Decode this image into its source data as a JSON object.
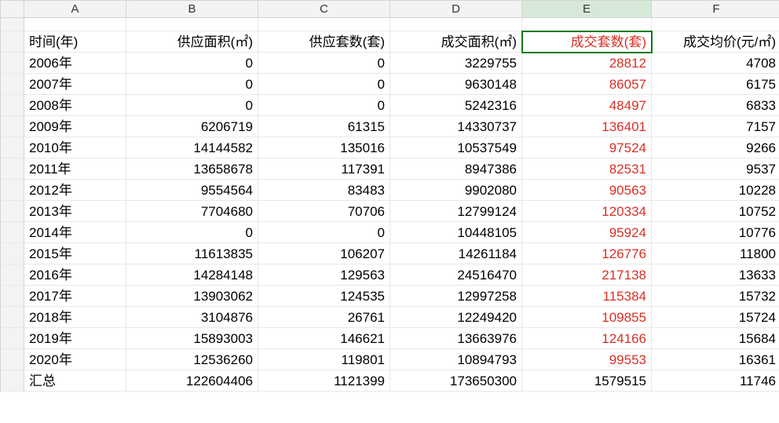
{
  "columns": [
    "",
    "A",
    "B",
    "C",
    "D",
    "E",
    "F"
  ],
  "selected": {
    "col": 5,
    "row": 2
  },
  "header": {
    "A": "时间(年)",
    "B": "供应面积(㎡)",
    "C": "供应套数(套)",
    "D": "成交面积(㎡)",
    "E": "成交套数(套)",
    "F": "成交均价(元/㎡)"
  },
  "rows": [
    {
      "A": "2006年",
      "B": 0,
      "C": 0,
      "D": 3229755,
      "E": 28812,
      "F": 4708
    },
    {
      "A": "2007年",
      "B": 0,
      "C": 0,
      "D": 9630148,
      "E": 86057,
      "F": 6175
    },
    {
      "A": "2008年",
      "B": 0,
      "C": 0,
      "D": 5242316,
      "E": 48497,
      "F": 6833
    },
    {
      "A": "2009年",
      "B": 6206719,
      "C": 61315,
      "D": 14330737,
      "E": 136401,
      "F": 7157
    },
    {
      "A": "2010年",
      "B": 14144582,
      "C": 135016,
      "D": 10537549,
      "E": 97524,
      "F": 9266
    },
    {
      "A": "2011年",
      "B": 13658678,
      "C": 117391,
      "D": 8947386,
      "E": 82531,
      "F": 9537
    },
    {
      "A": "2012年",
      "B": 9554564,
      "C": 83483,
      "D": 9902080,
      "E": 90563,
      "F": 10228
    },
    {
      "A": "2013年",
      "B": 7704680,
      "C": 70706,
      "D": 12799124,
      "E": 120334,
      "F": 10752
    },
    {
      "A": "2014年",
      "B": 0,
      "C": 0,
      "D": 10448105,
      "E": 95924,
      "F": 10776
    },
    {
      "A": "2015年",
      "B": 11613835,
      "C": 106207,
      "D": 14261184,
      "E": 126776,
      "F": 11800
    },
    {
      "A": "2016年",
      "B": 14284148,
      "C": 129563,
      "D": 24516470,
      "E": 217138,
      "F": 13633
    },
    {
      "A": "2017年",
      "B": 13903062,
      "C": 124535,
      "D": 12997258,
      "E": 115384,
      "F": 15732
    },
    {
      "A": "2018年",
      "B": 3104876,
      "C": 26761,
      "D": 12249420,
      "E": 109855,
      "F": 15724
    },
    {
      "A": "2019年",
      "B": 15893003,
      "C": 146621,
      "D": 13663976,
      "E": 124166,
      "F": 15684
    },
    {
      "A": "2020年",
      "B": 12536260,
      "C": 119801,
      "D": 10894793,
      "E": 99553,
      "F": 16361
    }
  ],
  "total": {
    "A": "汇总",
    "B": 122604406,
    "C": 1121399,
    "D": 173650300,
    "E": 1579515,
    "F": 11746
  }
}
